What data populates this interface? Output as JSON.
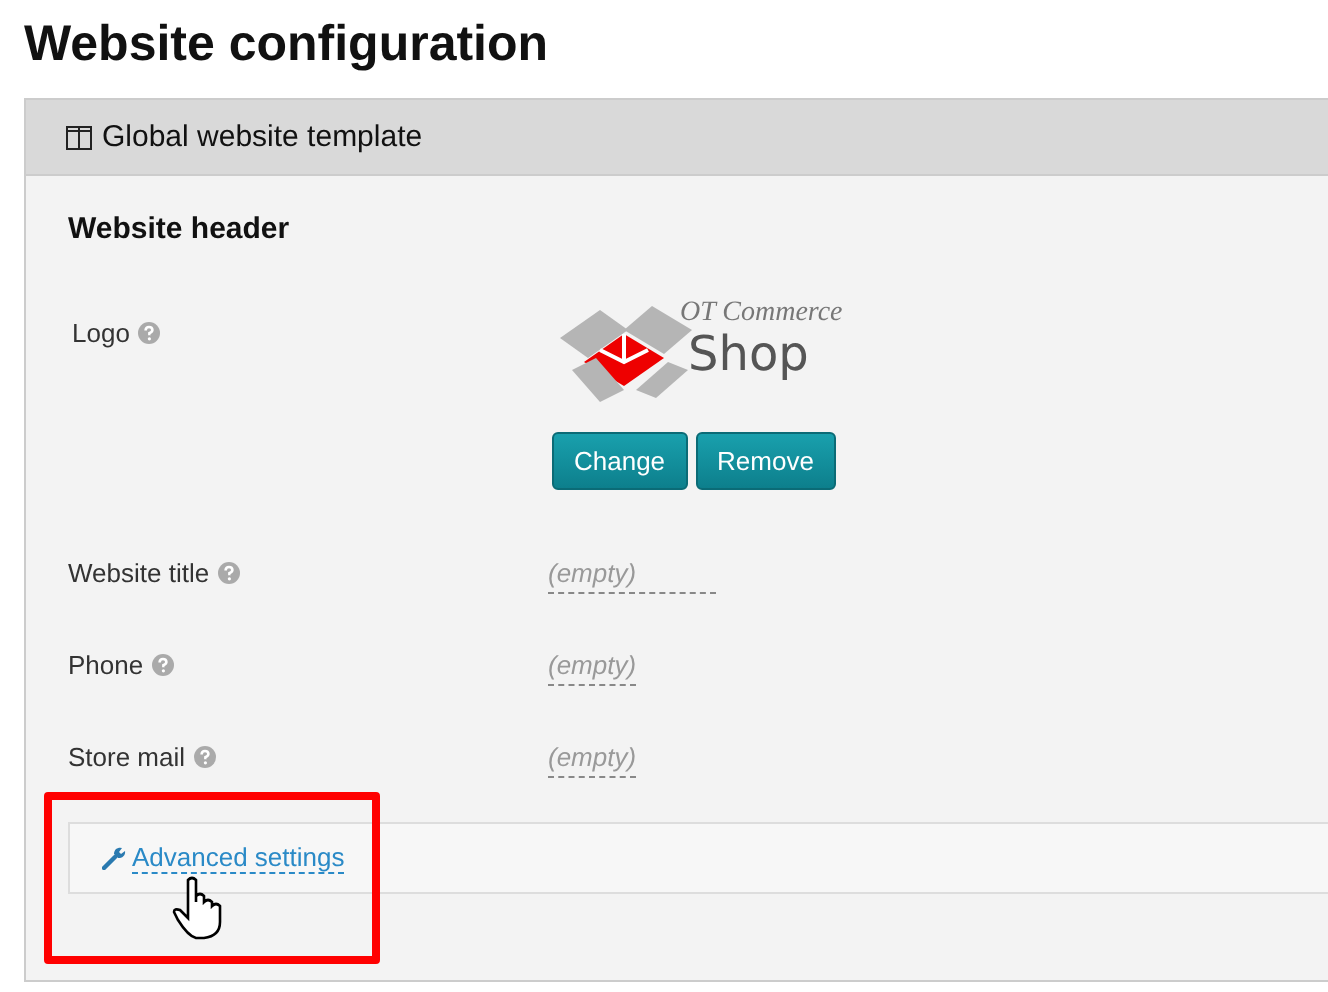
{
  "page_title": "Website configuration",
  "panel": {
    "title": "Global website template",
    "section_title": "Website header",
    "fields": [
      {
        "kind": "logo",
        "label": "Logo",
        "logo": {
          "line_1": "OT Commerce",
          "line_2": "Shop"
        },
        "buttons": [
          "Change",
          "Remove"
        ]
      },
      {
        "kind": "text",
        "label": "Website title",
        "value": "(empty)"
      },
      {
        "kind": "text",
        "label": "Phone",
        "value": "(empty)"
      },
      {
        "kind": "text",
        "label": "Store mail",
        "value": "(empty)"
      }
    ],
    "advanced_link": "Advanced settings"
  },
  "highlight": {
    "color": "#ff0000"
  }
}
